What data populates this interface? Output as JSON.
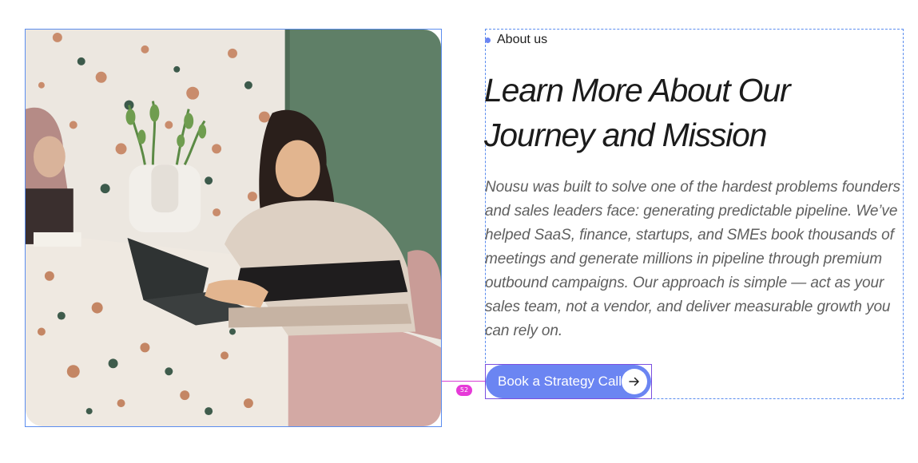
{
  "section": {
    "eyebrow": "About us",
    "headline": "Learn More About Our Journey and Mission",
    "body": "Nousu was built to solve one of the hardest problems founders and sales leaders face: generating predictable pipeline. We’ve helped SaaS, finance, startups, and SMEs book thousands of meetings and generate millions in pipeline through premium outbound campaigns. Our approach is simple — act as your sales team, not a vendor, and deliver measurable growth you can rely on.",
    "cta_label": "Book a Strategy Call",
    "cta_icon": "arrow-right-icon"
  },
  "editor": {
    "spacing_value": "52"
  },
  "colors": {
    "accent": "#6b85f2",
    "selection": "#5b8def",
    "spacing_guide": "#e63ad8",
    "headline": "#1b1b1b",
    "body": "#5f5f5f"
  }
}
